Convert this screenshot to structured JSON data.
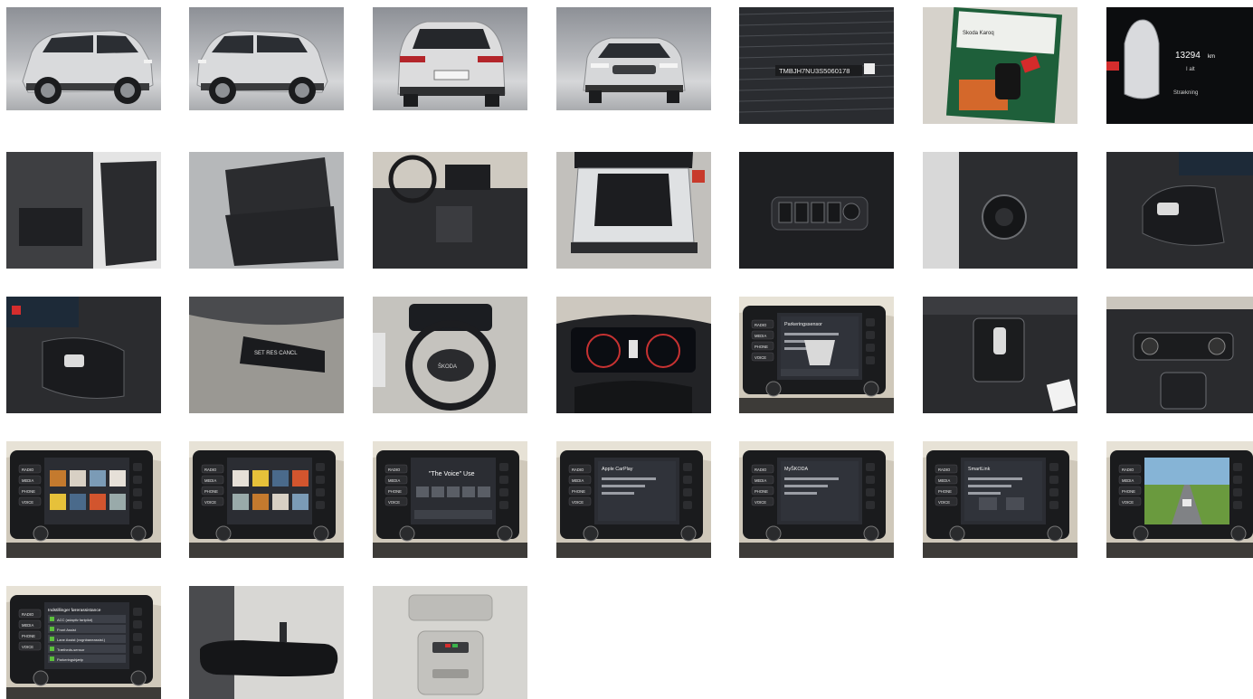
{
  "gallery": {
    "photos": [
      {
        "id": "photo-1",
        "subject": "car-front-three-quarter"
      },
      {
        "id": "photo-2",
        "subject": "car-rear-three-quarter"
      },
      {
        "id": "photo-3",
        "subject": "car-rear"
      },
      {
        "id": "photo-4",
        "subject": "car-front-three-quarter-right"
      },
      {
        "id": "photo-5",
        "subject": "vin-plate",
        "text": "TMBJH7NU3S5060178"
      },
      {
        "id": "photo-6",
        "subject": "keys-and-manual",
        "text": "Skoda Karoq"
      },
      {
        "id": "photo-7",
        "subject": "odometer",
        "mileage": "13294",
        "unit": "km",
        "caption": "I alt",
        "sub": "Strækning"
      },
      {
        "id": "photo-8",
        "subject": "front-door-interior"
      },
      {
        "id": "photo-9",
        "subject": "rear-seats"
      },
      {
        "id": "photo-10",
        "subject": "cockpit-overview"
      },
      {
        "id": "photo-11",
        "subject": "trunk-open"
      },
      {
        "id": "photo-12",
        "subject": "window-switches"
      },
      {
        "id": "photo-13",
        "subject": "light-switch"
      },
      {
        "id": "photo-14",
        "subject": "steering-wheel-buttons-right"
      },
      {
        "id": "photo-15",
        "subject": "steering-wheel-buttons-left"
      },
      {
        "id": "photo-16",
        "subject": "cruise-control-stalk",
        "text": "SET RES CANCL"
      },
      {
        "id": "photo-17",
        "subject": "steering-wheel",
        "text": "ŠKODA"
      },
      {
        "id": "photo-18",
        "subject": "digital-cockpit"
      },
      {
        "id": "photo-19",
        "subject": "infotainment-parking",
        "text": "Parkeringssensor"
      },
      {
        "id": "photo-20",
        "subject": "gear-selector"
      },
      {
        "id": "photo-21",
        "subject": "climate-controls"
      },
      {
        "id": "photo-22",
        "subject": "infotainment-media"
      },
      {
        "id": "photo-23",
        "subject": "infotainment-apps"
      },
      {
        "id": "photo-24",
        "subject": "infotainment-voice",
        "text": "\"The Voice\" Use"
      },
      {
        "id": "photo-25",
        "subject": "infotainment-wireless",
        "text": "Apple CarPlay"
      },
      {
        "id": "photo-26",
        "subject": "infotainment-security",
        "text": "MyŠKODA"
      },
      {
        "id": "photo-27",
        "subject": "infotainment-smartlink",
        "text": "SmartLink"
      },
      {
        "id": "photo-28",
        "subject": "infotainment-assist-camera"
      },
      {
        "id": "photo-29",
        "subject": "infotainment-driver-assist",
        "text": "Indstillinger førerassistance"
      },
      {
        "id": "photo-30",
        "subject": "rear-view-mirror"
      },
      {
        "id": "photo-31",
        "subject": "overhead-console"
      }
    ],
    "menu_labels": [
      "RADIO",
      "MEDIA",
      "PHONE",
      "VOICE"
    ],
    "menu_labels_short": [
      "RADIO",
      "MEDIA",
      "PHONE",
      "VOICE"
    ],
    "assist_items": [
      "ACC (adaptiv fartpilot)",
      "Front Assist",
      "Lane Assist (vognbaneassist.)",
      "Trætheds-sensor",
      "Parkeringshjælp"
    ]
  }
}
